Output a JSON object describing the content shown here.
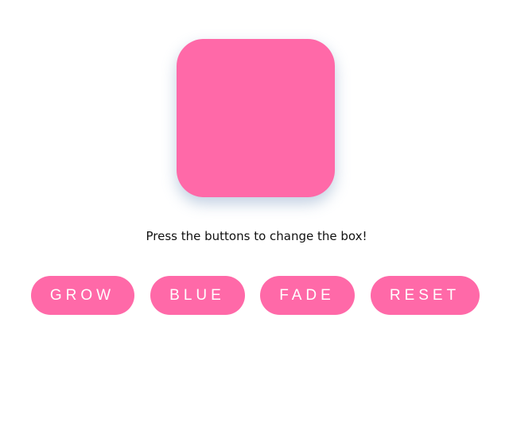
{
  "box": {
    "color": "#ff69a8"
  },
  "instruction": {
    "text": "Press the buttons to change the box!"
  },
  "buttons": {
    "grow_label": "GROW",
    "blue_label": "BLUE",
    "fade_label": "FADE",
    "reset_label": "RESET",
    "color": "#ff69a8",
    "text_color": "#ffffff"
  }
}
